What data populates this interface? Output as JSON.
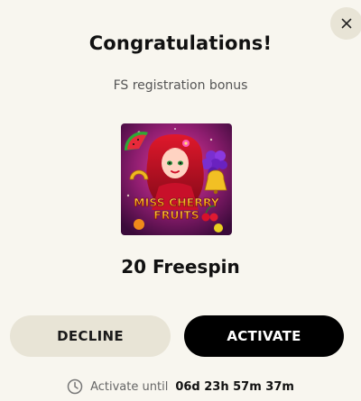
{
  "dialog": {
    "title": "Congratulations!",
    "subtitle": "FS registration bonus",
    "game": {
      "logo_line1": "MISS CHERRY",
      "logo_line2": "FRUITS"
    },
    "offer": "20 Freespin",
    "decline_label": "DECLINE",
    "activate_label": "ACTIVATE",
    "timer": {
      "label": "Activate until",
      "value": "06d 23h 57m 37m"
    },
    "colors": {
      "background": "#f8f6ef",
      "decline_button": "#e8e4d6",
      "activate_button": "#000000",
      "activate_text": "#ffffff"
    },
    "icons": {
      "close": "close-icon",
      "timer": "clock-icon"
    }
  }
}
